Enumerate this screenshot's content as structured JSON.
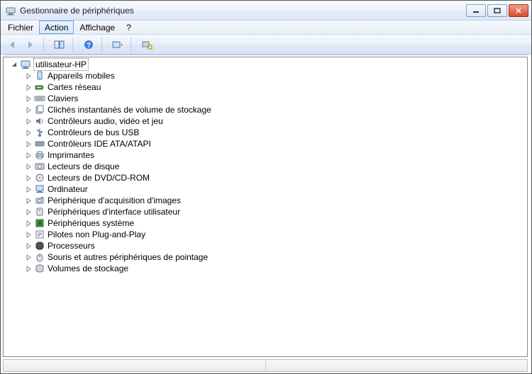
{
  "window": {
    "title": "Gestionnaire de périphériques"
  },
  "menubar": {
    "items": [
      {
        "label": "Fichier",
        "highlight": false
      },
      {
        "label": "Action",
        "highlight": true
      },
      {
        "label": "Affichage",
        "highlight": false
      },
      {
        "label": "?",
        "highlight": false
      }
    ]
  },
  "toolbar": {
    "back": "back-icon",
    "forward": "forward-icon",
    "show_hide": "show-hide-icon",
    "help": "help-icon",
    "settings": "settings-icon",
    "scan": "scan-hardware-icon"
  },
  "tree": {
    "root": {
      "label": "utilisateur-HP",
      "expanded": true,
      "icon": "computer-icon"
    },
    "children": [
      {
        "label": "Appareils mobiles",
        "icon": "mobile-device-icon"
      },
      {
        "label": "Cartes réseau",
        "icon": "network-adapter-icon"
      },
      {
        "label": "Claviers",
        "icon": "keyboard-icon"
      },
      {
        "label": "Clichés instantanés de volume de stockage",
        "icon": "volume-shadow-icon"
      },
      {
        "label": "Contrôleurs audio, vidéo et jeu",
        "icon": "sound-controller-icon"
      },
      {
        "label": "Contrôleurs de bus USB",
        "icon": "usb-controller-icon"
      },
      {
        "label": "Contrôleurs IDE ATA/ATAPI",
        "icon": "ide-controller-icon"
      },
      {
        "label": "Imprimantes",
        "icon": "printer-icon"
      },
      {
        "label": "Lecteurs de disque",
        "icon": "disk-drive-icon"
      },
      {
        "label": "Lecteurs de DVD/CD-ROM",
        "icon": "optical-drive-icon"
      },
      {
        "label": "Ordinateur",
        "icon": "computer-category-icon"
      },
      {
        "label": "Périphérique d'acquisition d'images",
        "icon": "imaging-device-icon"
      },
      {
        "label": "Périphériques d'interface utilisateur",
        "icon": "hid-device-icon"
      },
      {
        "label": "Périphériques système",
        "icon": "system-device-icon"
      },
      {
        "label": "Pilotes non Plug-and-Play",
        "icon": "legacy-driver-icon"
      },
      {
        "label": "Processeurs",
        "icon": "processor-icon"
      },
      {
        "label": "Souris et autres périphériques de pointage",
        "icon": "mouse-icon"
      },
      {
        "label": "Volumes de stockage",
        "icon": "storage-volume-icon"
      }
    ]
  }
}
